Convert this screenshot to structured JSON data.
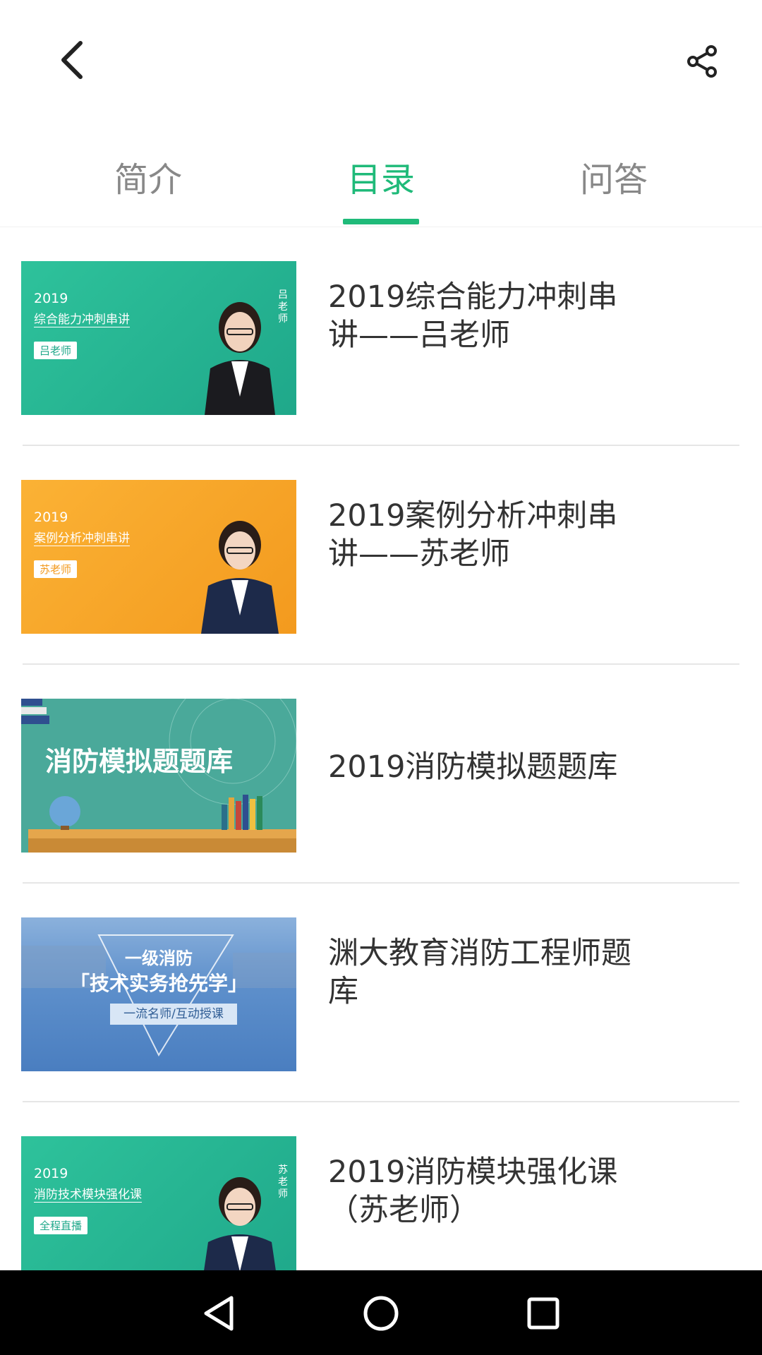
{
  "header": {
    "back_icon": "chevron-left-icon",
    "share_icon": "share-icon"
  },
  "tabs": [
    {
      "label": "简介",
      "active": false
    },
    {
      "label": "目录",
      "active": true
    },
    {
      "label": "问答",
      "active": false
    }
  ],
  "accent_color": "#1fba79",
  "courses": [
    {
      "title_line1": "2019综合能力冲刺串",
      "title_line2": "讲——吕老师",
      "thumb": {
        "year": "2019",
        "subtitle": "综合能力冲刺串讲",
        "badge": "吕老师",
        "side": "吕老师",
        "bg": "#28b894"
      }
    },
    {
      "title_line1": "2019案例分析冲刺串",
      "title_line2": "讲——苏老师",
      "thumb": {
        "year": "2019",
        "subtitle": "案例分析冲刺串讲",
        "badge": "苏老师",
        "bg": "#f7a52a"
      }
    },
    {
      "title_line1": "2019消防模拟题题库",
      "title_line2": "",
      "thumb": {
        "headline": "消防模拟题题库",
        "bg": "#4aa99a"
      }
    },
    {
      "title_line1": "渊大教育消防工程师题",
      "title_line2": "库",
      "thumb": {
        "line1": "一级消防",
        "line2": "「技术实务抢先学」",
        "line3": "一流名师/互动授课",
        "bg": "#4a80c0"
      }
    },
    {
      "title_line1": "2019消防模块强化课",
      "title_line2": "（苏老师）",
      "thumb": {
        "year": "2019",
        "subtitle": "消防技术模块强化课",
        "badge": "全程直播",
        "side": "苏老师",
        "bg": "#28b894"
      }
    }
  ],
  "navbar": {
    "back_icon": "triangle-back-icon",
    "home_icon": "circle-home-icon",
    "recent_icon": "square-recent-icon"
  }
}
